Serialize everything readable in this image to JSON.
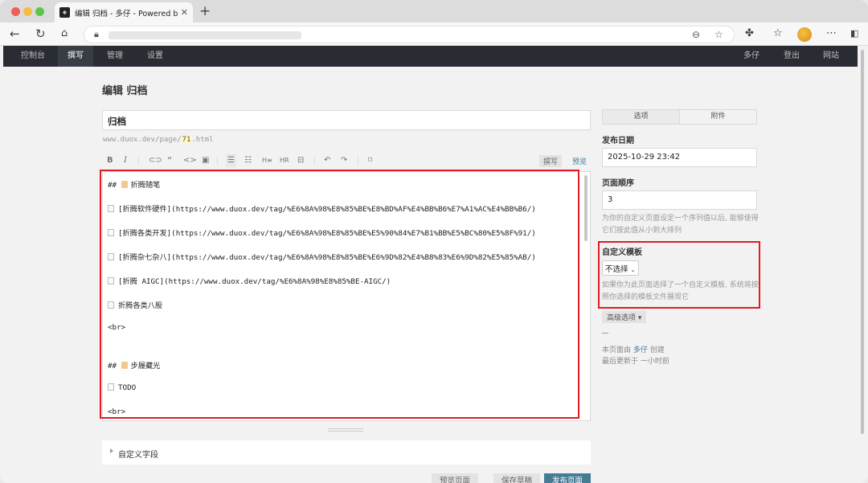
{
  "browser": {
    "tab_title": "编辑 归档 - 多仔 - Powered by T",
    "tab_close": "✕",
    "new_tab": "+"
  },
  "adminnav": {
    "left": [
      "控制台",
      "撰写",
      "管理",
      "设置"
    ],
    "right": [
      "多仔",
      "登出",
      "网站"
    ]
  },
  "page": {
    "title": "编辑 归档",
    "post_title": "归档",
    "slug_prefix": "www.duox.dev/page/",
    "slug_id": "71",
    "slug_suffix": ".html"
  },
  "editor": {
    "mode_write": "撰写",
    "mode_preview": "预览",
    "lines": [
      {
        "icon": "memo",
        "text": "折腾随笔",
        "prefix": "## "
      },
      {
        "icon": "note",
        "text": "[折腾软件硬件](https://www.duox.dev/tag/%E6%8A%98%E8%85%BE%E8%BD%AF%E4%BB%B6%E7%A1%AC%E4%BB%B6/)",
        "prefix": ""
      },
      {
        "icon": "note",
        "text": "[折腾各类开发](https://www.duox.dev/tag/%E6%8A%98%E8%85%BE%E5%90%84%E7%B1%BB%E5%BC%80%E5%8F%91/)",
        "prefix": ""
      },
      {
        "icon": "note",
        "text": "[折腾杂七杂八](https://www.duox.dev/tag/%E6%8A%98%E8%85%BE%E6%9D%82%E4%B8%83%E6%9D%82%E5%85%AB/)",
        "prefix": ""
      },
      {
        "icon": "note",
        "text": "[折腾 AIGC](https://www.duox.dev/tag/%E6%8A%98%E8%85%BE-AIGC/)",
        "prefix": ""
      },
      {
        "icon": "note",
        "text": "折腾各类八股",
        "prefix": ""
      },
      {
        "icon": "",
        "text": "<br>",
        "prefix": ""
      },
      {
        "icon": "memo",
        "text": "步履藏光",
        "prefix": "## "
      },
      {
        "icon": "note",
        "text": "TODO",
        "prefix": ""
      },
      {
        "icon": "",
        "text": "<br>",
        "prefix": ""
      }
    ]
  },
  "custom_fields": {
    "label": "自定义字段"
  },
  "bottom_buttons": [
    "预览页面",
    "保存草稿",
    "发布页面"
  ],
  "sidebar": {
    "tabs": [
      "选项",
      "附件"
    ],
    "publish_date": {
      "label": "发布日期",
      "value": "2025-10-29 23:42"
    },
    "page_order": {
      "label": "页面顺序",
      "value": "3",
      "help": "为你的自定义页面设定一个序列值以后, 能够使得它们按此值从小到大排列"
    },
    "template": {
      "label": "自定义模板",
      "selected": "不选择",
      "help": "如果你为此页面选择了一个自定义模板, 系统将按照你选择的模板文件展现它"
    },
    "advanced": "高级选项",
    "author_prefix": "本页面由",
    "author": "多仔",
    "author_suffix": "创建",
    "updated": "最后更新于 一小时前"
  },
  "colors": {
    "highlight_box": "#e11c24",
    "link": "#467b96",
    "adminbar": "#292d33"
  }
}
